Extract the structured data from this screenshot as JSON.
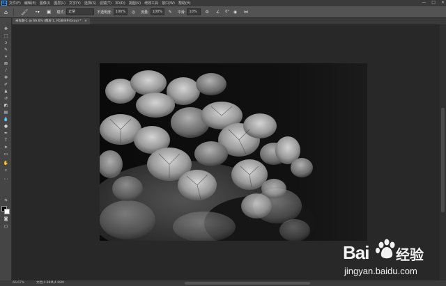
{
  "app": {
    "logo_text": "Ps"
  },
  "menubar": {
    "items": [
      "文件(F)",
      "编辑(E)",
      "图像(I)",
      "图层(L)",
      "文字(Y)",
      "选择(S)",
      "滤镜(T)",
      "3D(D)",
      "视图(V)",
      "增效工具",
      "窗口(W)",
      "帮助(H)"
    ],
    "window_buttons": [
      "—",
      "□",
      "✕"
    ]
  },
  "options_bar": {
    "mode_label": "模式:",
    "mode_value": "正常",
    "opacity_label": "不透明度:",
    "opacity_value": "100%",
    "flow_label": "流量:",
    "flow_value": "100%",
    "smoothing_label": "平滑:",
    "smoothing_value": "10%",
    "angle_value": "0°"
  },
  "document_tab": {
    "label": "未标题-1 @ 66.6% (图层 1, RGB/8#/Gray) *",
    "close": "×"
  },
  "status_bar": {
    "zoom": "66.67%",
    "doc_info": "文档:4.88M/4.88M"
  },
  "watermark": {
    "brand": "Bai",
    "brand_cn": "经验",
    "url": "jingyan.baidu.com"
  },
  "colors": {
    "foreground": "#000000",
    "background": "#ffffff",
    "accent": "#31a8ff"
  },
  "tools": [
    "move-icon",
    "marquee-icon",
    "lasso-icon",
    "quick-select-icon",
    "crop-icon",
    "frame-icon",
    "eyedropper-icon",
    "healing-brush-icon",
    "brush-icon",
    "clone-stamp-icon",
    "history-brush-icon",
    "eraser-icon",
    "gradient-icon",
    "blur-icon",
    "dodge-icon",
    "pen-icon",
    "type-icon",
    "path-select-icon",
    "shape-icon",
    "hand-icon",
    "zoom-icon",
    "more-tools-icon"
  ]
}
